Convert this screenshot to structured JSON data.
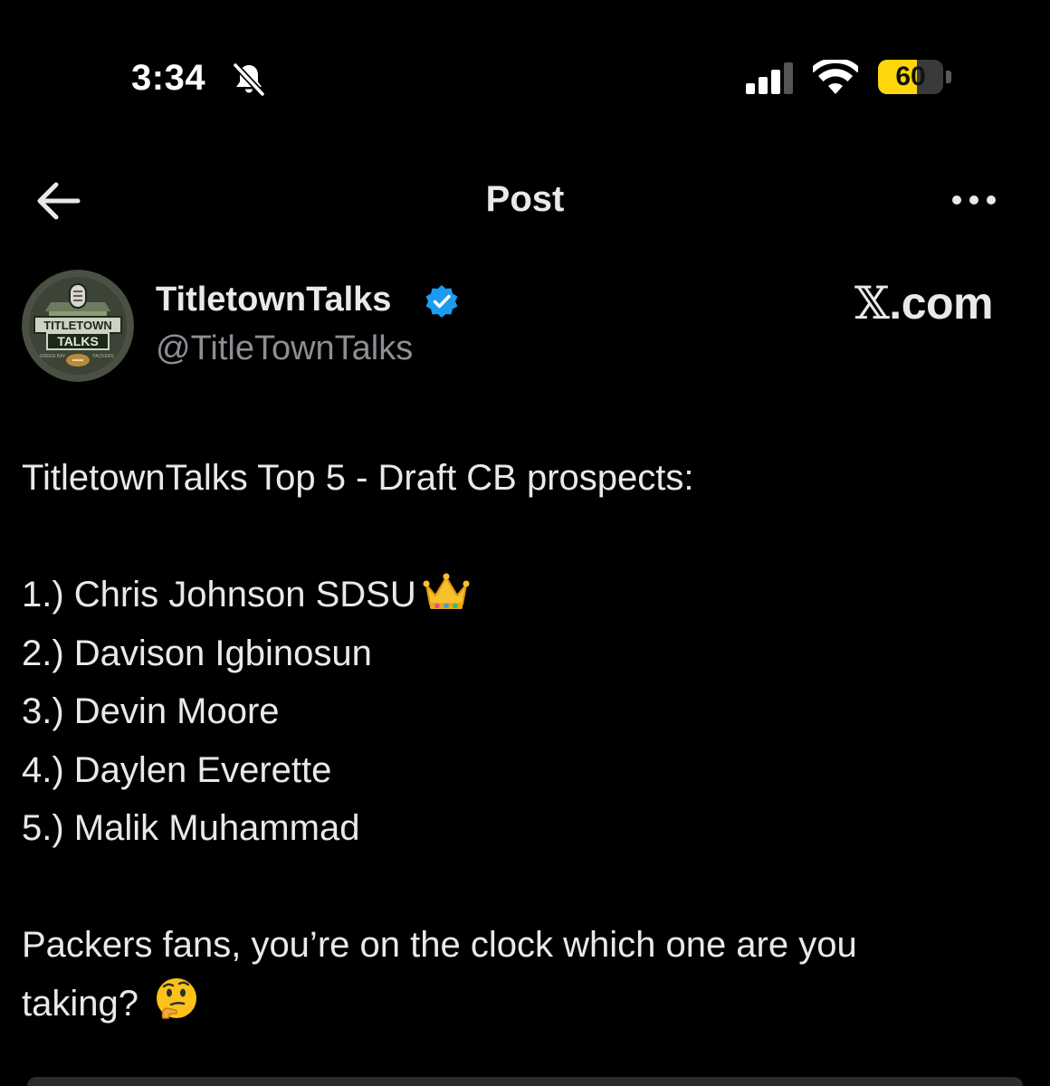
{
  "status_bar": {
    "time": "3:34",
    "battery_percent": "60",
    "battery_level": 0.6,
    "signal_bars": 3,
    "silent_mode_icon": "bell-slash-icon",
    "wifi_icon": "wifi-icon"
  },
  "header": {
    "title": "Post",
    "back_icon": "arrow-left-icon",
    "more_icon": "more-dots-icon"
  },
  "author": {
    "name": "TitletownTalks",
    "handle": "@TitleTownTalks",
    "verified": true,
    "avatar_text": [
      "TITLETOWN",
      "TALKS",
      "GREEN BAY",
      "PACKERS"
    ]
  },
  "watermark": {
    "x": "𝕏",
    "text": ".com"
  },
  "post": {
    "intro": "TitletownTalks Top 5 - Draft CB prospects:",
    "prospects": [
      "1.) Chris Johnson SDSU",
      "2.) Davison Igbinosun",
      "3.) Devin Moore",
      "4.) Daylen Everette",
      "5.) Malik Muhammad"
    ],
    "question_line1": "Packers fans, you’re on the clock which one are you",
    "question_line2": "taking?",
    "emojis": [
      "crown-emoji",
      "thinking-face-emoji"
    ]
  },
  "colors": {
    "background": "#000000",
    "text": "#e7e9ea",
    "secondary_text": "#8b8f94",
    "verified_blue": "#1d9bf0",
    "battery_yellow": "#ffd60a"
  }
}
